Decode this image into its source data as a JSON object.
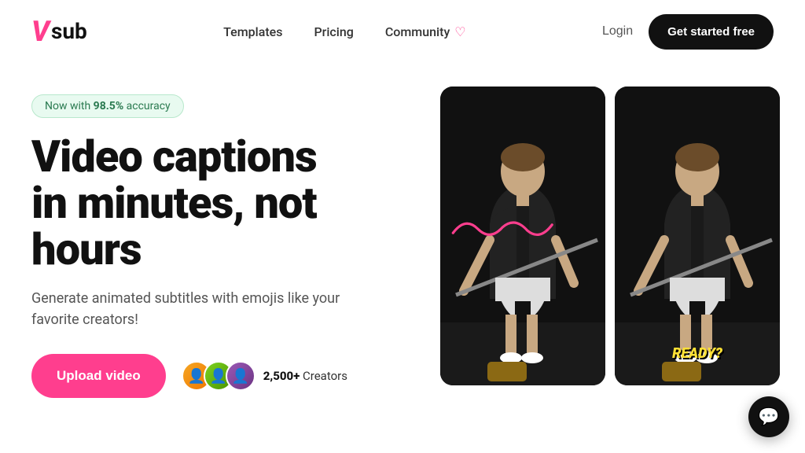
{
  "brand": {
    "logo_v": "V",
    "logo_sub": "sub"
  },
  "nav": {
    "templates_label": "Templates",
    "pricing_label": "Pricing",
    "community_label": "Community",
    "community_icon": "♡",
    "login_label": "Login",
    "get_started_label": "Get started free"
  },
  "hero": {
    "badge_prefix": "Now with ",
    "badge_accent": "98.5%",
    "badge_suffix": " accuracy",
    "title_line1": "Video captions",
    "title_line2": "in minutes, not",
    "title_line3": "hours",
    "subtitle": "Generate animated subtitles with emojis like your favorite creators!",
    "upload_label": "Upload video",
    "creators_count": "2,500+",
    "creators_label": " Creators",
    "video_label": "READY?"
  },
  "chat": {
    "icon": "💬"
  }
}
